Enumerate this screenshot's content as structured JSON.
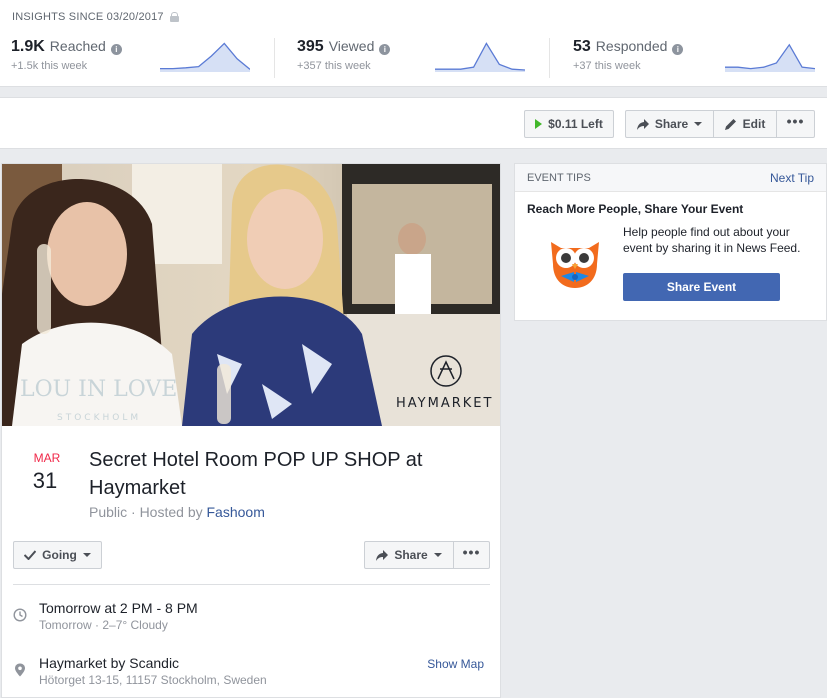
{
  "insights": {
    "title": "INSIGHTS SINCE 03/20/2017",
    "stats": [
      {
        "num": "1.9K",
        "label": "Reached",
        "sub": "+1.5k this week",
        "trend": [
          0.05,
          0.05,
          0.08,
          0.12,
          0.5,
          0.95,
          0.4,
          0.02
        ]
      },
      {
        "num": "395",
        "label": "Viewed",
        "sub": "+357 this week",
        "trend": [
          0.03,
          0.03,
          0.03,
          0.1,
          0.95,
          0.2,
          0.03,
          0.0
        ]
      },
      {
        "num": "53",
        "label": "Responded",
        "sub": "+37 this week",
        "trend": [
          0.1,
          0.1,
          0.05,
          0.1,
          0.25,
          0.9,
          0.1,
          0.05
        ]
      }
    ]
  },
  "toolbar": {
    "budget_label": "$0.11 Left",
    "share_label": "Share",
    "edit_label": "Edit",
    "more_label": "•••"
  },
  "event": {
    "cover_texts": {
      "brand_left": "LOU IN LOVE",
      "brand_left_sub": "STOCKHOLM",
      "brand_right": "HAYMARKET"
    },
    "month": "MAR",
    "day": "31",
    "title": "Secret Hotel Room POP UP SHOP at Haymarket",
    "privacy": "Public · Hosted by ",
    "host": "Fashoom",
    "going_label": "Going",
    "share_label": "Share",
    "more_label": "•••",
    "time_main": "Tomorrow at 2 PM - 8 PM",
    "time_sub": "Tomorrow · 2–7° Cloudy",
    "place_main": "Haymarket by Scandic",
    "place_sub": "Hötorget 13-15, 11157 Stockholm, Sweden",
    "map_label": "Show Map"
  },
  "tips": {
    "header": "EVENT TIPS",
    "next_label": "Next Tip",
    "title": "Reach More People, Share Your Event",
    "text": "Help people find out about your event by sharing it in News Feed.",
    "button_label": "Share Event"
  },
  "colors": {
    "accent": "#4267b2",
    "link": "#365899",
    "date_red": "#f02849",
    "spark_fill": "#d6e0f5",
    "spark_line": "#5b7bd5"
  }
}
